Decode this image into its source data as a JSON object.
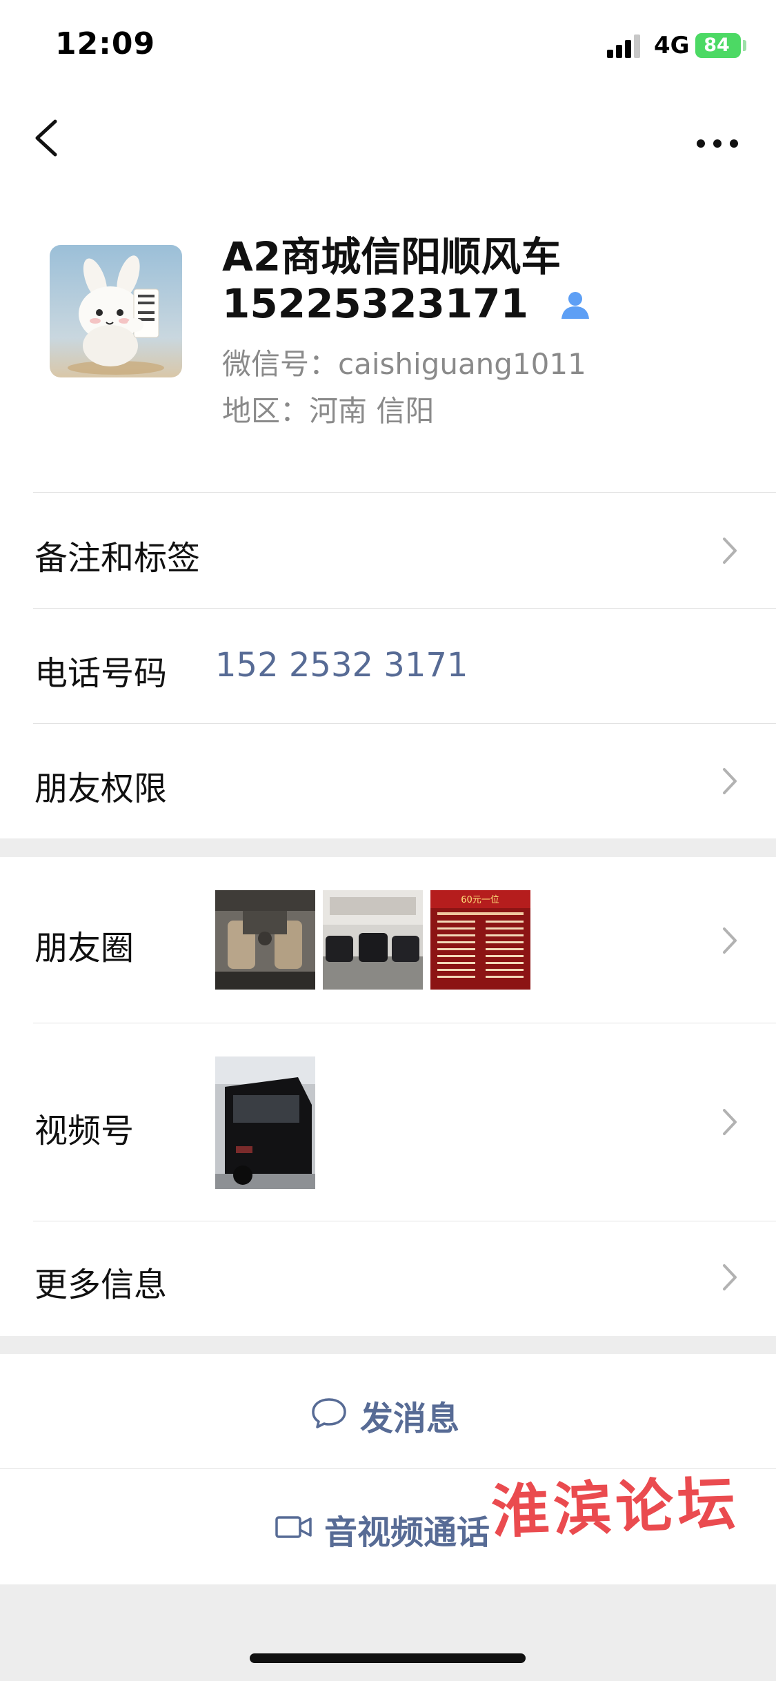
{
  "status_bar": {
    "time": "12:09",
    "network": "4G",
    "battery": "84",
    "battery_color": "#4cd964"
  },
  "nav": {
    "back_icon": "chevron-left-icon",
    "more_icon": "more-horizontal-icon"
  },
  "profile": {
    "name_line1": "A2商城信阳顺风车",
    "name_line2": "15225323171",
    "wechat_id": "微信号：caishiguang1011",
    "region": "地区：河南 信阳",
    "badge_icon": "contact-person-icon",
    "badge_color": "#5d9ff5"
  },
  "rows": {
    "remark": {
      "label": "备注和标签"
    },
    "phone": {
      "label": "电话号码",
      "value": "152 2532 3171"
    },
    "permission": {
      "label": "朋友权限"
    },
    "moments": {
      "label": "朋友圈",
      "thumbnails": [
        "moments-photo-van-interior",
        "moments-photo-parked-vans",
        "moments-photo-schedule-poster"
      ]
    },
    "channels": {
      "label": "视频号",
      "thumbnails": [
        "channels-video-black-van"
      ]
    },
    "more_info": {
      "label": "更多信息"
    }
  },
  "poster_text": "60元一位",
  "actions": {
    "message": {
      "label": "发消息",
      "icon": "chat-bubble-icon"
    },
    "call": {
      "label": "音视频通话",
      "icon": "video-camera-icon"
    }
  },
  "link_color": "#576b95",
  "watermark": "淮滨论坛"
}
